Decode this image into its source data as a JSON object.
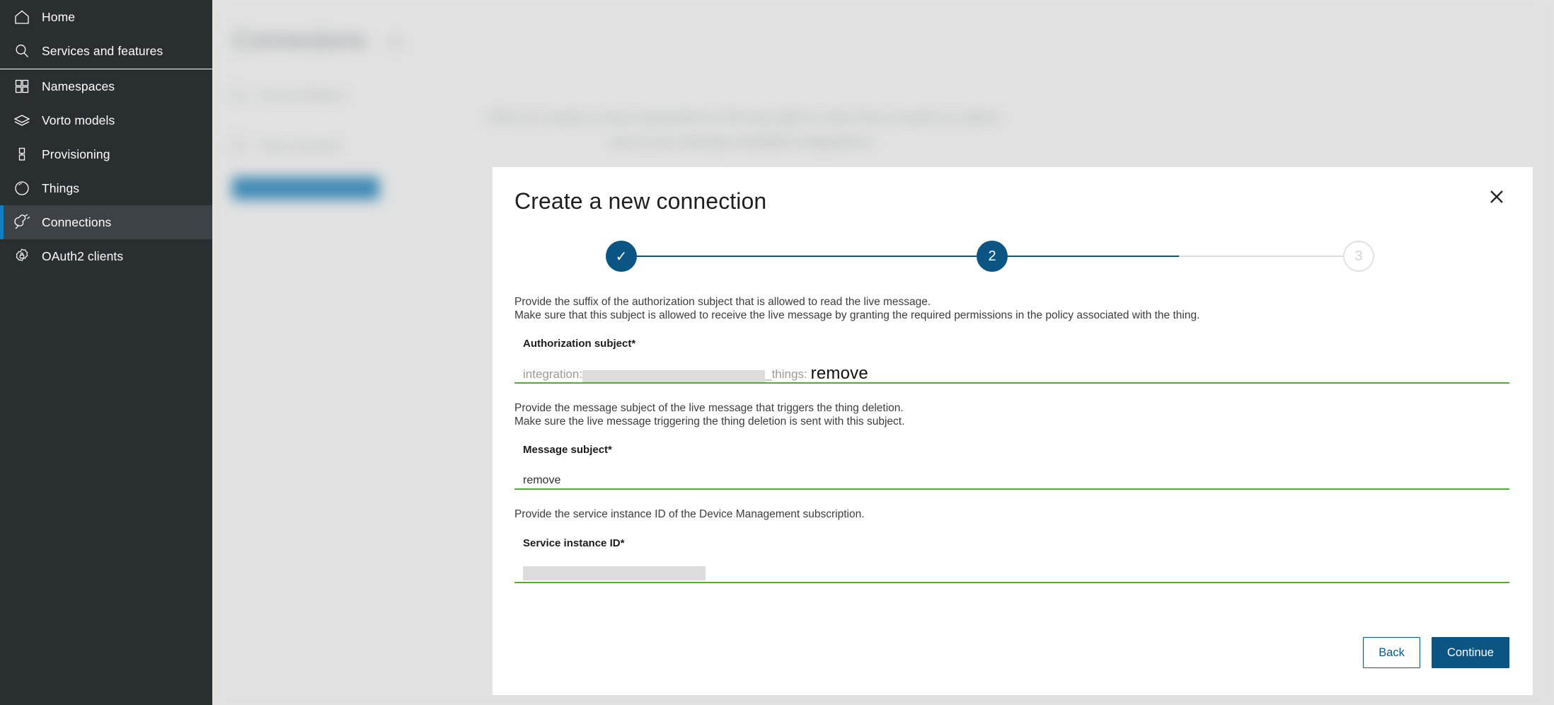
{
  "sidebar": {
    "items": [
      {
        "label": "Home",
        "icon": "home-icon",
        "active": false
      },
      {
        "label": "Services and features",
        "icon": "search-icon",
        "active": false
      },
      {
        "label": "Namespaces",
        "icon": "grid-icon",
        "active": false
      },
      {
        "label": "Vorto models",
        "icon": "layers-icon",
        "active": false
      },
      {
        "label": "Provisioning",
        "icon": "database-icon",
        "active": false
      },
      {
        "label": "Things",
        "icon": "circle-icon",
        "active": false
      },
      {
        "label": "Connections",
        "icon": "plug-icon",
        "active": true
      },
      {
        "label": "OAuth2 clients",
        "icon": "gear-lock-icon",
        "active": false
      }
    ]
  },
  "background_page": {
    "title": "Connections",
    "row_1": "Documentation",
    "row_2": "Show all items",
    "button_label": "Create connection",
    "empty_message_line_1": "Click on create a new connection in the top right to start from scratch or select",
    "empty_message_line_2": "one of our already available integrations."
  },
  "modal": {
    "title": "Create a new connection",
    "close_icon": "close-icon",
    "stepper": {
      "steps": [
        {
          "label": "✓",
          "state": "done"
        },
        {
          "label": "2",
          "state": "current"
        },
        {
          "label": "3",
          "state": "todo"
        }
      ]
    },
    "sections": [
      {
        "description_line_1": "Provide the suffix of the authorization subject that is allowed to read the live message.",
        "description_line_2": "Make sure that this subject is allowed to receive the live message by granting the required permissions in the policy associated with the thing.",
        "label": "Authorization subject*",
        "prefix_1": "integration:",
        "prefix_2": "_things:",
        "value": "remove"
      },
      {
        "description_line_1": "Provide the message subject of the live message that triggers the thing deletion.",
        "description_line_2": "Make sure the live message triggering the thing deletion is sent with this subject.",
        "label": "Message subject*",
        "value": "remove"
      },
      {
        "description_line_1": "Provide the service instance ID of the Device Management subscription.",
        "description_line_2": "",
        "label": "Service instance ID*",
        "value": ""
      }
    ],
    "buttons": {
      "back_label": "Back",
      "continue_label": "Continue"
    }
  },
  "colors": {
    "sidebar_bg": "#292e31",
    "accent_blue": "#0f80c1",
    "primary_blue": "#0a5583",
    "input_underline_green": "#53ae2f",
    "redaction_gray": "#dcdcdc"
  }
}
